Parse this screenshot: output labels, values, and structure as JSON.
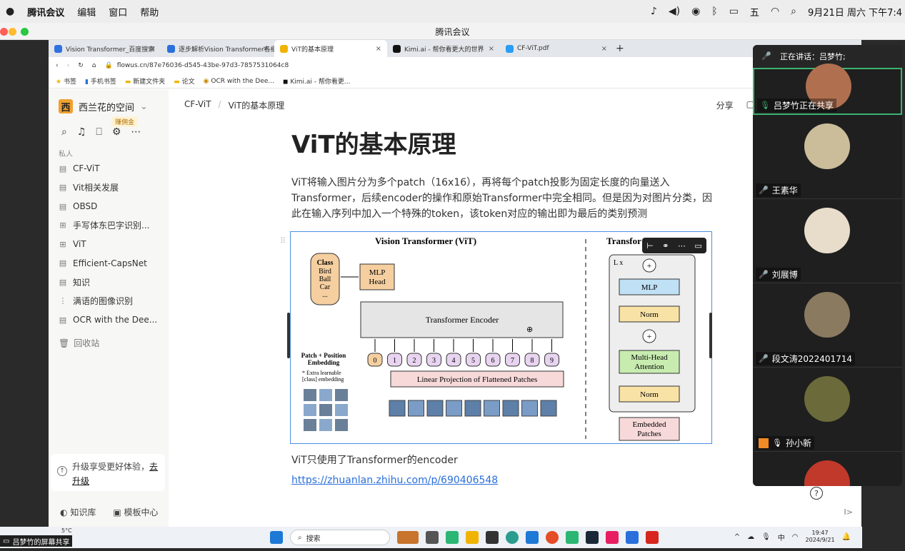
{
  "menubar": {
    "app": "腾讯会议",
    "items": [
      "编辑",
      "窗口",
      "帮助"
    ],
    "clock": "9月21日 周六 下午7:4",
    "ime": "五"
  },
  "window": {
    "title": "腾讯会议"
  },
  "browser": {
    "tabs": [
      {
        "label": "Vision Transformer_百度搜索",
        "color": "#3070e0"
      },
      {
        "label": "逐步解析Vision Transformer各细",
        "color": "#2a6fdb"
      },
      {
        "label": "ViT的基本原理",
        "color": "#f0b400",
        "active": true
      },
      {
        "label": "Kimi.ai - 帮你看更大的世界",
        "color": "#111"
      },
      {
        "label": "CF-ViT.pdf",
        "color": "#2a9df4"
      }
    ],
    "new_tab": "+",
    "url": "flowus.cn/87e76036-d545-43be-97d3-7857531064c8",
    "bookmarks": [
      "书签",
      "手机书签",
      "新建文件夹",
      "论文",
      "OCR with the Dee...",
      "Kimi.ai - 帮你看更..."
    ]
  },
  "sidebar": {
    "workspace": "西兰花的空间",
    "logo": "西",
    "badge": "赚佣金",
    "section": "私人",
    "items": [
      {
        "label": "CF-ViT",
        "icon": "doc"
      },
      {
        "label": "Vit相关发展",
        "icon": "doc"
      },
      {
        "label": "OBSD",
        "icon": "doc"
      },
      {
        "label": "手写体东巴字识别...",
        "icon": "table"
      },
      {
        "label": "ViT",
        "icon": "table"
      },
      {
        "label": "Efficient-CapsNet",
        "icon": "doc"
      },
      {
        "label": "知识",
        "icon": "doc"
      },
      {
        "label": "满语的图像识别",
        "icon": "outline"
      },
      {
        "label": "OCR with the Dee...",
        "icon": "doc"
      }
    ],
    "trash": "回收站",
    "upgrade_text": "升级享受更好体验，",
    "upgrade_link_a": "去",
    "upgrade_link_b": "升级",
    "bottom": [
      "知识库",
      "模板中心"
    ]
  },
  "page": {
    "breadcrumb": [
      "CF-ViT",
      "ViT的基本原理"
    ],
    "share": "分享",
    "title": "ViT的基本原理",
    "paragraph": "ViT将输入图片分为多个patch（16x16），再将每个patch投影为固定长度的向量送入Transformer，后续encoder的操作和原始Transformer中完全相同。但是因为对图片分类，因此在输入序列中加入一个特殊的token，该token对应的输出即为最后的类别预测",
    "para2": "ViT只使用了Transformer的encoder",
    "link": "https://zhuanlan.zhihu.com/p/690406548",
    "corner": "I>"
  },
  "figure": {
    "left_title": "Vision Transformer (ViT)",
    "right_title": "Transfor",
    "class_box": [
      "Class",
      "Bird",
      "Ball",
      "Car",
      "..."
    ],
    "mlp_head": [
      "MLP",
      "Head"
    ],
    "encoder": "Transformer Encoder",
    "patch_label": [
      "Patch + Position",
      "Embedding"
    ],
    "extra_note": [
      "* Extra learnable",
      "[class] embedding"
    ],
    "tokens": [
      "0",
      "1",
      "2",
      "3",
      "4",
      "5",
      "6",
      "7",
      "8",
      "9"
    ],
    "linear": "Linear Projection of Flattened Patches",
    "lx": "L x",
    "block_mlp": "MLP",
    "norm": "Norm",
    "mha": [
      "Multi-Head",
      "Attention"
    ],
    "embedded": [
      "Embedded",
      "Patches"
    ]
  },
  "panel": {
    "speaking": "正在讲话：吕梦竹;",
    "participants": [
      {
        "name": "吕梦竹正在共享",
        "color": "#b07050"
      },
      {
        "name": "王素华",
        "color": "#cbbd9a"
      },
      {
        "name": "刘展博",
        "color": "#e8dccb"
      },
      {
        "name": "段文涛2022401714",
        "color": "#8a7a60"
      },
      {
        "name": "孙小新",
        "color": "#6b6a3a"
      },
      {
        "name": "",
        "color": "#c0392b"
      }
    ]
  },
  "taskbar": {
    "search": "搜索",
    "ime": "中",
    "time": "19:47",
    "date": "2024/9/21",
    "weather": "5°C"
  },
  "share_label": "吕梦竹的屏幕共享",
  "help": "?"
}
